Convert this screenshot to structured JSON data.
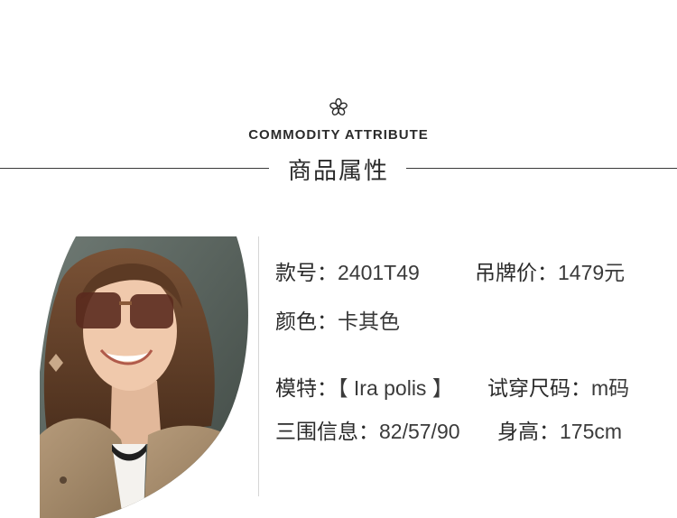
{
  "header": {
    "ornament_icon": "flower-icon",
    "title_en": "COMMODITY ATTRIBUTE",
    "title_cn": "商品属性"
  },
  "photo": {
    "description_icon": "model-photo"
  },
  "attributes": {
    "style_no_label": "款号：",
    "style_no_value": "2401T49",
    "price_label": "吊牌价：",
    "price_value": "1479元",
    "color_label": "颜色：",
    "color_value": "卡其色",
    "model_label": "模特：",
    "model_value": "【 Ira polis 】",
    "size_label": "试穿尺码：",
    "size_value": "m码",
    "measure_label": "三围信息：",
    "measure_value": "82/57/90",
    "height_label": "身高：",
    "height_value": "175cm"
  }
}
